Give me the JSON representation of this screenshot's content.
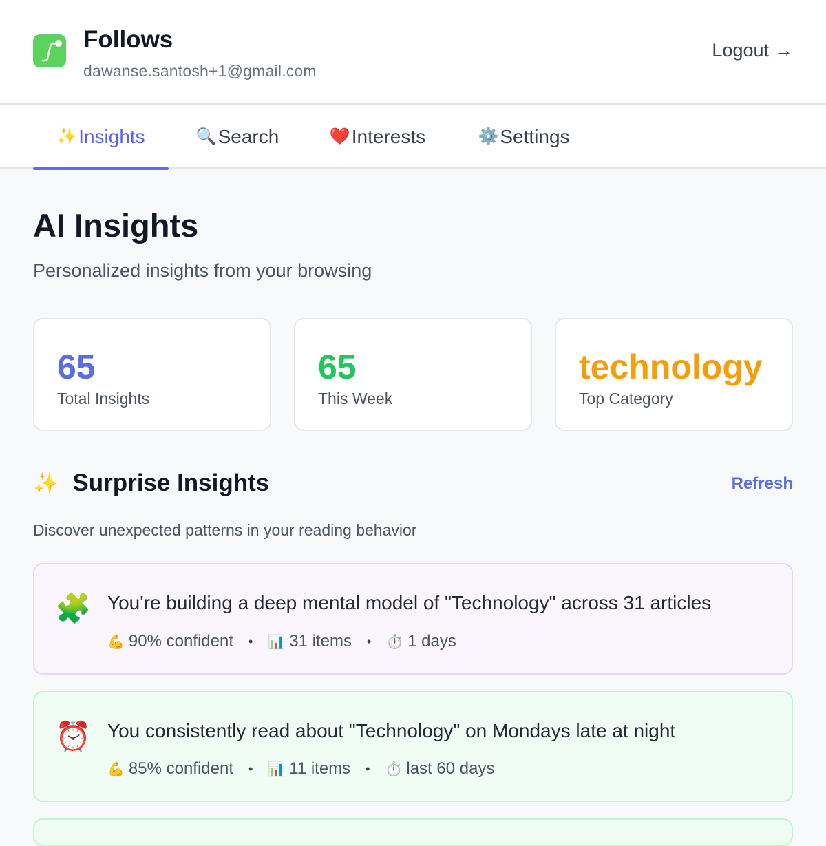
{
  "app": {
    "title": "Follows",
    "email": "dawanse.santosh+1@gmail.com",
    "logout_label": "Logout",
    "logout_icon": "→",
    "brand_color": "#5dd35f"
  },
  "tabs": [
    {
      "icon": "✨",
      "label": "Insights",
      "active": true
    },
    {
      "icon": "🔍",
      "label": "Search",
      "active": false
    },
    {
      "icon": "❤️",
      "label": "Interests",
      "active": false
    },
    {
      "icon": "⚙️",
      "label": "Settings",
      "active": false
    }
  ],
  "page": {
    "title": "AI Insights",
    "subtitle": "Personalized insights from your browsing"
  },
  "stats": [
    {
      "value": "65",
      "label": "Total Insights",
      "color": "#5b6ee0"
    },
    {
      "value": "65",
      "label": "This Week",
      "color": "#22c55e"
    },
    {
      "value": "technology",
      "label": "Top Category",
      "color": "#f59e0b"
    }
  ],
  "surprise": {
    "icon": "✨",
    "title": "Surprise Insights",
    "refresh_label": "Refresh",
    "subtitle": "Discover unexpected patterns in your reading behavior",
    "cards": [
      {
        "icon": "🧩",
        "text": "You're building a deep mental model of \"Technology\" across 31 articles",
        "confidence_icon": "💪",
        "confidence": "90% confident",
        "items_icon": "📊",
        "items": "31 items",
        "time_icon": "⏱️",
        "time": "1 days",
        "bg": "#faf5ff",
        "border": "#e9d5ff"
      },
      {
        "icon": "⏰",
        "text": "You consistently read about \"Technology\" on Mondays late at night",
        "confidence_icon": "💪",
        "confidence": "85% confident",
        "items_icon": "📊",
        "items": "11 items",
        "time_icon": "⏱️",
        "time": "last 60 days",
        "bg": "#f0fdf4",
        "border": "#bbf7d0"
      }
    ]
  }
}
